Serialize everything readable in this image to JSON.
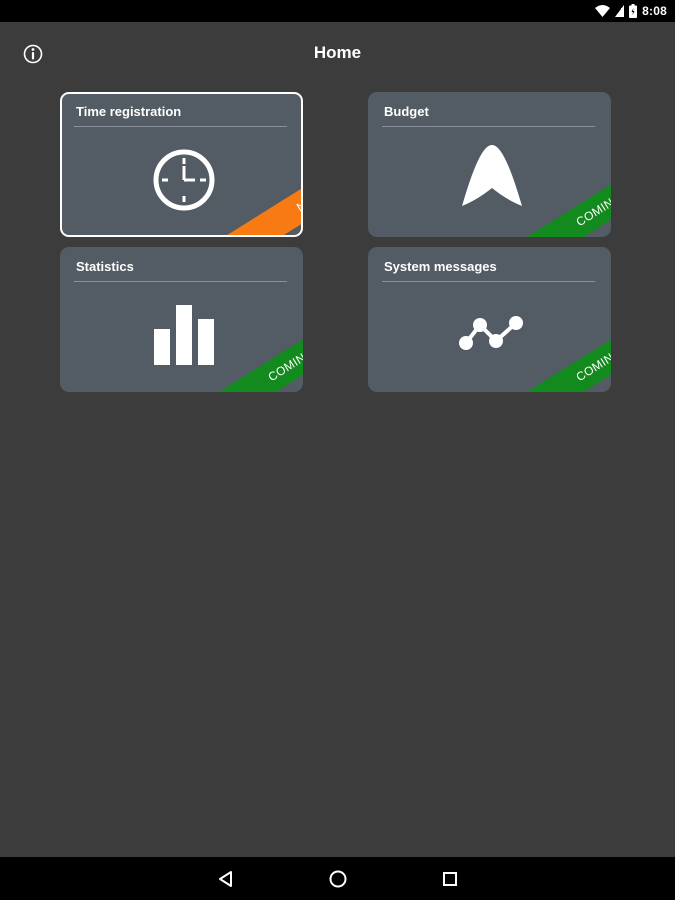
{
  "status_bar": {
    "time": "8:08",
    "icons": [
      "wifi-icon",
      "signal-icon",
      "battery-icon"
    ]
  },
  "app_bar": {
    "title": "Home",
    "info_icon": "info-icon"
  },
  "tiles": [
    {
      "title": "Time registration",
      "icon": "clock-icon",
      "ribbon": "NEW",
      "ribbon_color": "#f77b12"
    },
    {
      "title": "Budget",
      "icon": "budget-icon",
      "ribbon": "COMING SOON",
      "ribbon_color": "#138a1e"
    },
    {
      "title": "Statistics",
      "icon": "bar-chart-icon",
      "ribbon": "COMING SOON",
      "ribbon_color": "#138a1e"
    },
    {
      "title": "System messages",
      "icon": "graph-nodes-icon",
      "ribbon": "COMING SOON",
      "ribbon_color": "#138a1e"
    }
  ],
  "nav_bar": {
    "icons": [
      "back-icon",
      "home-icon",
      "recents-icon"
    ]
  },
  "colors": {
    "background": "#3c3c3c",
    "tile": "#535b64",
    "new_ribbon": "#f77b12",
    "coming_soon_ribbon": "#138a1e"
  }
}
